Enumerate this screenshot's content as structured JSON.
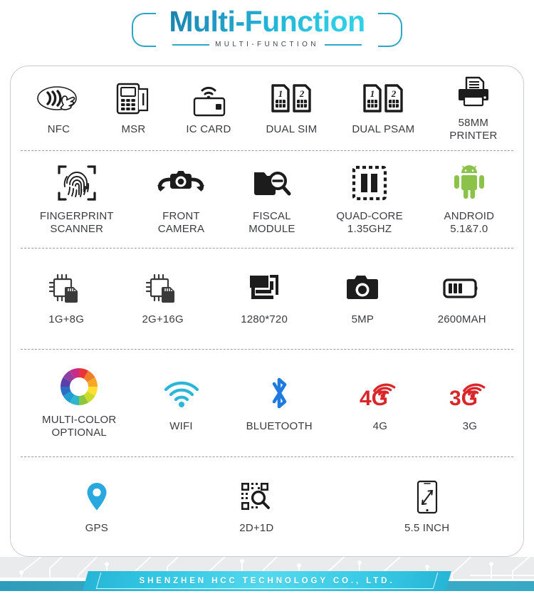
{
  "header": {
    "title": "Multi-Function",
    "subtitle": "MULTI-FUNCTION"
  },
  "footer": {
    "company": "SHENZHEN HCC TECHNOLOGY CO., LTD."
  },
  "colors": {
    "title_gradient_start": "#1a7fa8",
    "title_gradient_end": "#31d3e8",
    "accent_cyan": "#2ba6c6",
    "label_text": "#3a3d40",
    "icon_dark": "#1c1c1c",
    "android_green": "#8bc34a",
    "wifi_cyan": "#29b6d8",
    "bluetooth_blue": "#1f7ae0",
    "signal_red": "#d9262b",
    "gps_blue": "#29a8e0",
    "footer_band": "#37a9c6"
  },
  "rows": [
    {
      "id": "row-connectivity",
      "items": [
        {
          "icon": "nfc-icon",
          "label": "NFC"
        },
        {
          "icon": "msr-icon",
          "label": "MSR"
        },
        {
          "icon": "ic-card-icon",
          "label": "IC CARD"
        },
        {
          "icon": "dual-sim-icon",
          "label": "DUAL SIM"
        },
        {
          "icon": "dual-psam-icon",
          "label": "DUAL PSAM"
        },
        {
          "icon": "printer-icon",
          "label": "58MM\nPRINTER"
        }
      ]
    },
    {
      "id": "row-hardware",
      "items": [
        {
          "icon": "fingerprint-icon",
          "label": "FINGERPRINT\nSCANNER"
        },
        {
          "icon": "front-camera-icon",
          "label": "FRONT\nCAMERA"
        },
        {
          "icon": "fiscal-module-icon",
          "label": "FISCAL\nMODULE"
        },
        {
          "icon": "quad-core-icon",
          "label": "QUAD-CORE\n1.35GHZ"
        },
        {
          "icon": "android-icon",
          "label": "ANDROID\n5.1&7.0"
        }
      ]
    },
    {
      "id": "row-specs",
      "items": [
        {
          "icon": "memory-1g8g-icon",
          "label": "1G+8G"
        },
        {
          "icon": "memory-2g16g-icon",
          "label": "2G+16G"
        },
        {
          "icon": "resolution-icon",
          "label": "1280*720"
        },
        {
          "icon": "camera-icon",
          "label": "5MP"
        },
        {
          "icon": "battery-icon",
          "label": "2600MAH"
        }
      ]
    },
    {
      "id": "row-wireless",
      "items": [
        {
          "icon": "color-wheel-icon",
          "label": "MULTI-COLOR\nOPTIONAL"
        },
        {
          "icon": "wifi-icon",
          "label": "WIFI"
        },
        {
          "icon": "bluetooth-icon",
          "label": "BLUETOOTH"
        },
        {
          "icon": "signal-4g-icon",
          "label": "4G"
        },
        {
          "icon": "signal-3g-icon",
          "label": "3G"
        }
      ]
    },
    {
      "id": "row-extras",
      "items": [
        {
          "icon": "gps-icon",
          "label": "GPS"
        },
        {
          "icon": "barcode-scanner-icon",
          "label": "2D+1D"
        },
        {
          "icon": "screen-size-icon",
          "label": "5.5 INCH"
        }
      ]
    }
  ]
}
